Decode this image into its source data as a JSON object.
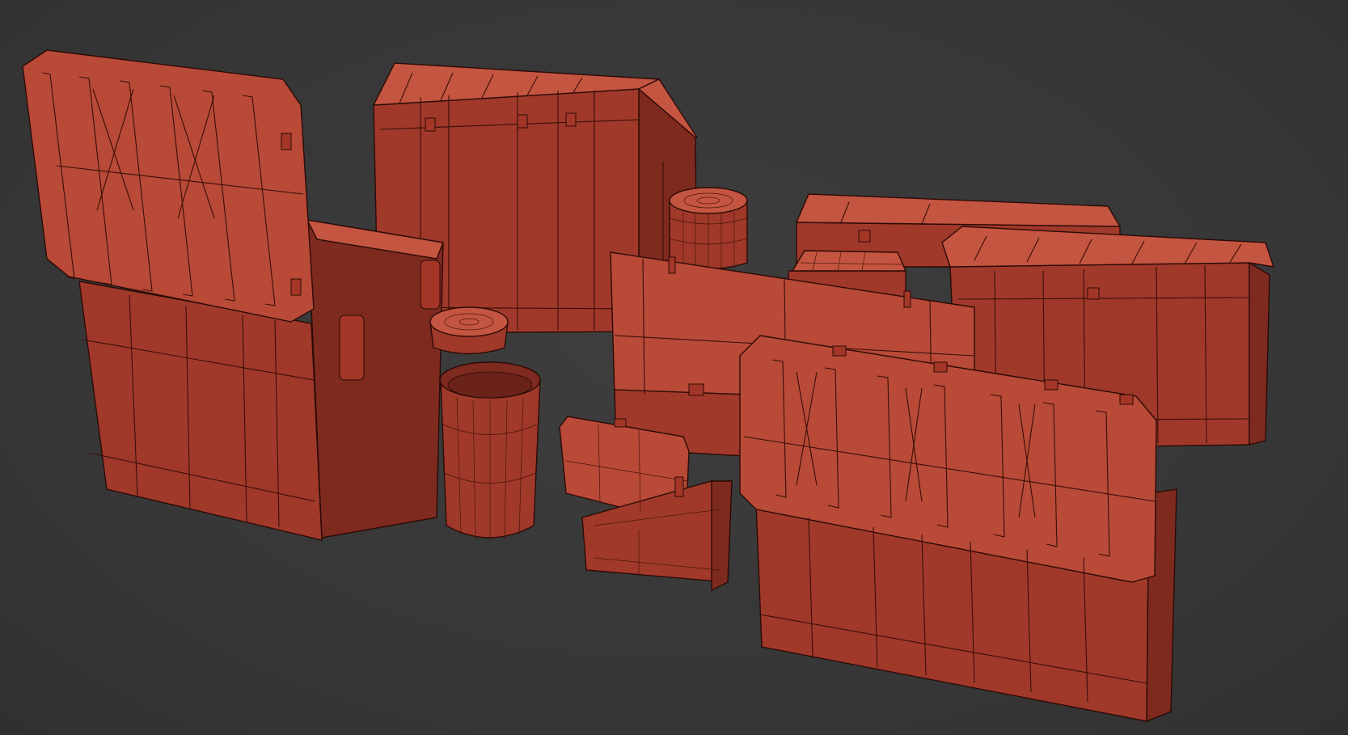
{
  "viewport": {
    "background_color": "#3a3a3a",
    "model_color_light": "#b84a37",
    "model_color_mid": "#a0392a",
    "model_color_dark": "#7e2a1f",
    "model_color_top": "#c45540",
    "wire_color": "#3a0e08"
  },
  "scene": {
    "objects": [
      {
        "name": "open-large-crate-left",
        "kind": "crate",
        "state": "open"
      },
      {
        "name": "closed-cube-crate-back",
        "kind": "crate",
        "state": "closed"
      },
      {
        "name": "small-barrel-back",
        "kind": "barrel",
        "state": "closed"
      },
      {
        "name": "open-barrel-middle",
        "kind": "barrel",
        "state": "open"
      },
      {
        "name": "small-open-case-middle",
        "kind": "case",
        "state": "open"
      },
      {
        "name": "open-flat-case-center",
        "kind": "case",
        "state": "open"
      },
      {
        "name": "small-case-center-back",
        "kind": "case",
        "state": "closed"
      },
      {
        "name": "long-closed-crate-right",
        "kind": "crate",
        "state": "closed"
      },
      {
        "name": "long-open-crate-front-right",
        "kind": "crate",
        "state": "open"
      }
    ]
  }
}
